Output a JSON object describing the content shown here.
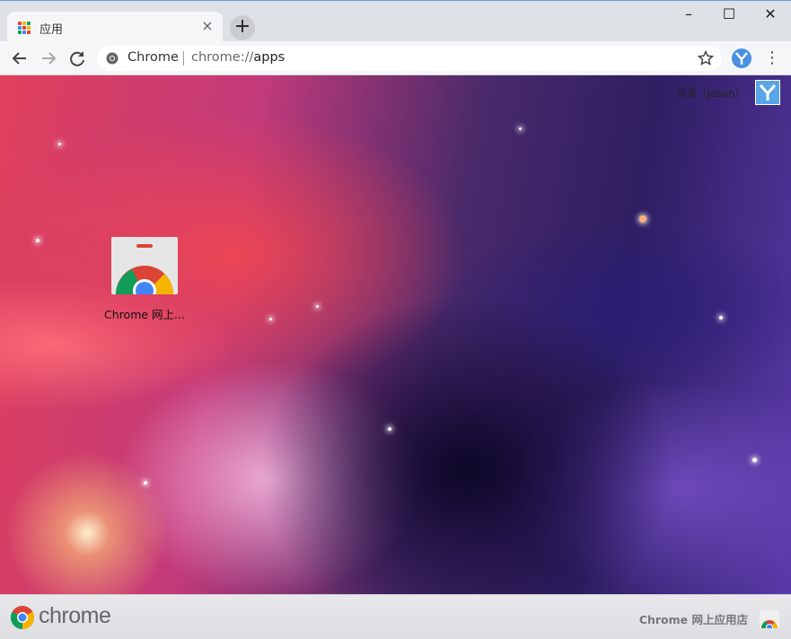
{
  "tab": {
    "title": "应用",
    "close_symbol": "×"
  },
  "window_controls": {
    "minimize": "–",
    "maximize": "☐",
    "close": "✕"
  },
  "omnibox": {
    "site_name": "Chrome",
    "url_scheme": "chrome://",
    "url_path": "apps"
  },
  "menu_symbol": "⋮",
  "new_tab_symbol": "+",
  "user": {
    "name": "月清（Jason）"
  },
  "apps": [
    {
      "label": "Chrome 网上..."
    }
  ],
  "footer": {
    "wordmark": "chrome",
    "store_link": "Chrome 网上应用店"
  },
  "colors": {
    "accent_blue": "#4285f4",
    "chrome_red": "#db4437",
    "chrome_yellow": "#f4b400",
    "chrome_green": "#0f9d58"
  },
  "icons": [
    "apps-grid-icon",
    "close-icon",
    "plus-icon",
    "back-arrow-icon",
    "forward-arrow-icon",
    "reload-icon",
    "chrome-site-icon",
    "star-icon",
    "profile-icon",
    "menu-dots-icon",
    "chrome-logo-icon",
    "webstore-icon"
  ]
}
